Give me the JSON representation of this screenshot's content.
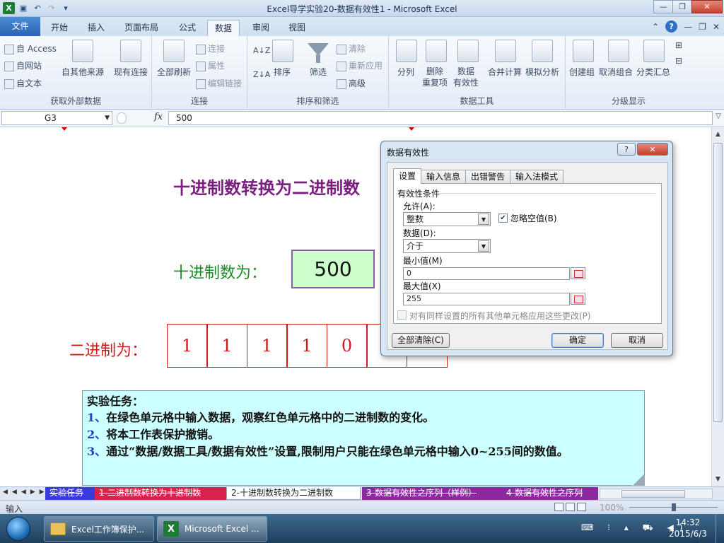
{
  "window": {
    "title": "Excel导学实验20-数据有效性1  -  Microsoft Excel",
    "app_icon": "X",
    "controls": [
      "minimize",
      "maximize",
      "close"
    ]
  },
  "ribbon": {
    "file_tab": "文件",
    "tabs": [
      "开始",
      "插入",
      "页面布局",
      "公式",
      "数据",
      "审阅",
      "视图"
    ],
    "active_tab": "数据",
    "groups": {
      "external": {
        "label": "获取外部数据",
        "small": [
          "自 Access",
          "自网站",
          "自文本"
        ],
        "big": [
          "自其他来源",
          "现有连接"
        ]
      },
      "connections": {
        "label": "连接",
        "big": "全部刷新",
        "small": [
          "连接",
          "属性",
          "编辑链接"
        ]
      },
      "sort_filter": {
        "label": "排序和筛选",
        "sort": "排序",
        "filter": "筛选",
        "small": [
          "清除",
          "重新应用",
          "高级"
        ],
        "az": "A↓Z",
        "za": "Z↓A"
      },
      "data_tools": {
        "label": "数据工具",
        "items": [
          "分列",
          "删除\n重复项",
          "数据\n有效性",
          "合并计算",
          "模拟分析"
        ]
      },
      "outline": {
        "label": "分级显示",
        "items": [
          "创建组",
          "取消组合",
          "分类汇总"
        ]
      }
    }
  },
  "formula_bar": {
    "name_box": "G3",
    "fx": "fx",
    "formula": "500"
  },
  "sheet": {
    "heading": "十进制数转换为二进制数",
    "decimal_label": "十进制数为：",
    "decimal_value": "500",
    "binary_label": "二进制为：",
    "binary_bits": [
      "1",
      "1",
      "1",
      "1",
      "0",
      "",
      ""
    ],
    "task": {
      "title": "实验任务：",
      "lines": [
        {
          "num": "1、",
          "text": "在绿色单元格中输入数据，观察红色单元格中的二进制数的变化。"
        },
        {
          "num": "2、",
          "text": "将本工作表保护撤销。"
        },
        {
          "num": "3、",
          "text": "通过“数据/数据工具/数据有效性”设置,限制用户只能在绿色单元格中输入0~255间的数值。"
        }
      ]
    }
  },
  "sheet_tabs": [
    {
      "label": "实验任务",
      "style": "blue"
    },
    {
      "label": "1-二进制数转换为十进制数",
      "style": "red"
    },
    {
      "label": "2-十进制数转换为二进制数",
      "style": "active"
    },
    {
      "label": "3-数据有效性之序列（样例）",
      "style": "purple"
    },
    {
      "label": "4-数据有效性之序列",
      "style": "purple"
    }
  ],
  "status_bar": {
    "mode": "输入",
    "zoom": "100%"
  },
  "dialog": {
    "title": "数据有效性",
    "tabs": [
      "设置",
      "输入信息",
      "出错警告",
      "输入法模式"
    ],
    "active_tab": "设置",
    "section": "有效性条件",
    "allow_label": "允许(A):",
    "allow_value": "整数",
    "ignore_blank_label": "忽略空值(B)",
    "ignore_blank_checked": true,
    "data_label": "数据(D):",
    "data_value": "介于",
    "min_label": "最小值(M)",
    "min_value": "0",
    "max_label": "最大值(X)",
    "max_value": "255",
    "apply_all_label": "对有同样设置的所有其他单元格应用这些更改(P)",
    "clear_all": "全部清除(C)",
    "ok": "确定",
    "cancel": "取消"
  },
  "taskbar": {
    "buttons": [
      {
        "label": "Excel工作簿保护...",
        "icon": "folder-icon"
      },
      {
        "label": "Microsoft Excel ...",
        "icon": "excel-icon"
      }
    ],
    "time": "14:32",
    "date": "2015/6/3"
  }
}
